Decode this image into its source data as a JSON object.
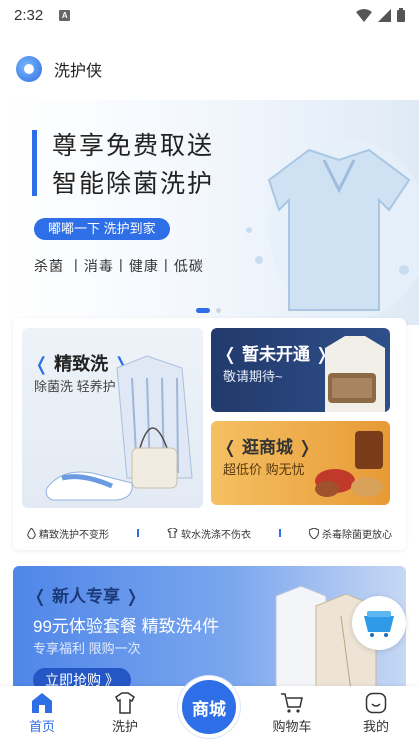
{
  "status_bar": {
    "time": "2:32",
    "notification_badge": "A"
  },
  "header": {
    "app_name": "洗护侠"
  },
  "hero": {
    "line1": "尊享免费取送",
    "line2": "智能除菌洗护",
    "pill": "嘟嘟一下 洗护到家",
    "tags": "杀菌 丨消毒丨健康丨低碳"
  },
  "services": {
    "fine_wash": {
      "title": "精致洗",
      "subtitle": "除菌洗 轻养护"
    },
    "not_open": {
      "title": "暂未开通",
      "subtitle": "敬请期待~"
    },
    "mall": {
      "title": "逛商城",
      "subtitle": "超低价 购无忧"
    },
    "features": [
      {
        "label": "精致洗护不变形"
      },
      {
        "label": "软水洗涤不伤衣"
      },
      {
        "label": "杀毒除菌更放心"
      }
    ]
  },
  "promo": {
    "title": "新人专享",
    "offer": "99元体验套餐 精致洗4件",
    "note": "专享福利 限购一次",
    "button": "立即抢购 》"
  },
  "tabbar": {
    "items": [
      {
        "label": "首页",
        "icon": "home-icon"
      },
      {
        "label": "洗护",
        "icon": "shirt-icon"
      },
      {
        "label": "商城",
        "icon": "mall-icon"
      },
      {
        "label": "购物车",
        "icon": "cart-icon"
      },
      {
        "label": "我的",
        "icon": "profile-icon"
      }
    ]
  },
  "colors": {
    "accent": "#2e6ee6"
  }
}
